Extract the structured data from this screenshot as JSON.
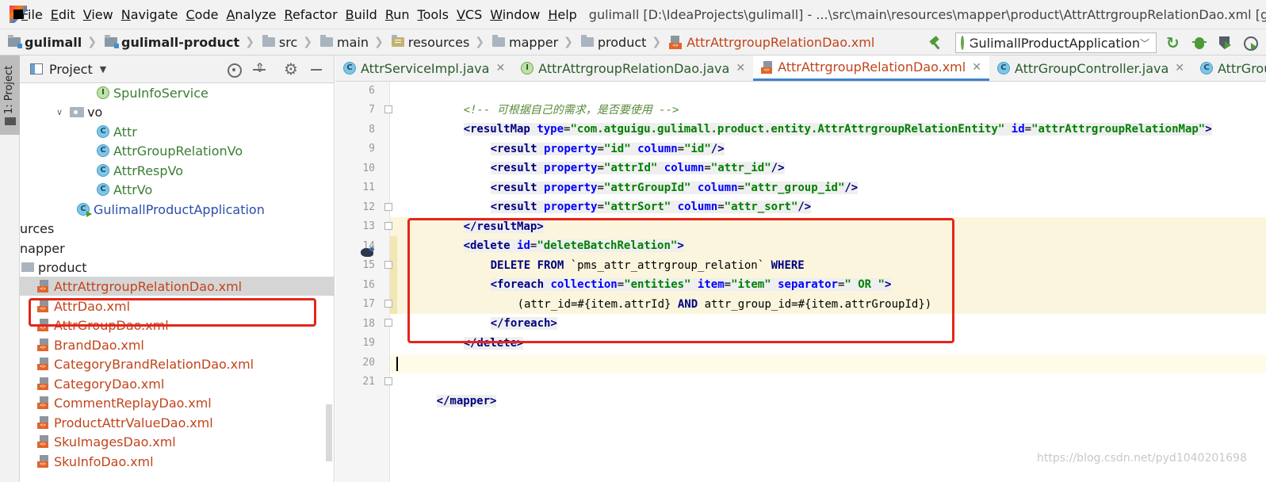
{
  "menubar": {
    "items": [
      "File",
      "Edit",
      "View",
      "Navigate",
      "Code",
      "Analyze",
      "Refactor",
      "Build",
      "Run",
      "Tools",
      "VCS",
      "Window",
      "Help"
    ],
    "window_title": "gulimall [D:\\IdeaProjects\\gulimall] - ...\\src\\main\\resources\\mapper\\product\\AttrAttrgroupRelationDao.xml [guli"
  },
  "breadcrumbs": [
    "gulimall",
    "gulimall-product",
    "src",
    "main",
    "resources",
    "mapper",
    "product",
    "AttrAttrgroupRelationDao.xml"
  ],
  "run_config": "GulimallProductApplication",
  "project_panel": {
    "title": "Project",
    "stripe_label": "1: Project",
    "tree": [
      {
        "label": "SpuInfoService",
        "icon": "interface-icon",
        "color": "#3b7e33"
      },
      {
        "label": "vo",
        "icon": "package-icon",
        "color": "#222222"
      },
      {
        "label": "Attr",
        "icon": "class-icon",
        "color": "#3b7e33"
      },
      {
        "label": "AttrGroupRelationVo",
        "icon": "class-icon",
        "color": "#3b7e33"
      },
      {
        "label": "AttrRespVo",
        "icon": "class-icon",
        "color": "#3b7e33"
      },
      {
        "label": "AttrVo",
        "icon": "class-icon",
        "color": "#3b7e33"
      },
      {
        "label": "GulimallProductApplication",
        "icon": "spring-app-icon",
        "color": "#2a4fa8"
      },
      {
        "label": "urces",
        "icon": "none",
        "color": "#222222"
      },
      {
        "label": "napper",
        "icon": "none",
        "color": "#222222"
      },
      {
        "label": "product",
        "icon": "folder-icon",
        "color": "#222222"
      },
      {
        "label": "AttrAttrgroupRelationDao.xml",
        "icon": "xml-file-icon",
        "color": "#c1441c"
      },
      {
        "label": "AttrDao.xml",
        "icon": "xml-file-icon",
        "color": "#c1441c"
      },
      {
        "label": "AttrGroupDao.xml",
        "icon": "xml-file-icon",
        "color": "#c1441c"
      },
      {
        "label": "BrandDao.xml",
        "icon": "xml-file-icon",
        "color": "#c1441c"
      },
      {
        "label": "CategoryBrandRelationDao.xml",
        "icon": "xml-file-icon",
        "color": "#c1441c"
      },
      {
        "label": "CategoryDao.xml",
        "icon": "xml-file-icon",
        "color": "#c1441c"
      },
      {
        "label": "CommentReplayDao.xml",
        "icon": "xml-file-icon",
        "color": "#c1441c"
      },
      {
        "label": "ProductAttrValueDao.xml",
        "icon": "xml-file-icon",
        "color": "#c1441c"
      },
      {
        "label": "SkuImagesDao.xml",
        "icon": "xml-file-icon",
        "color": "#c1441c"
      },
      {
        "label": "SkuInfoDao.xml",
        "icon": "xml-file-icon",
        "color": "#c1441c"
      }
    ],
    "selected_item": "AttrAttrgroupRelationDao.xml"
  },
  "editor": {
    "tabs": [
      {
        "label": "AttrServiceImpl.java",
        "icon": "class-icon",
        "active": false
      },
      {
        "label": "AttrAttrgroupRelationDao.java",
        "icon": "interface-icon",
        "active": false
      },
      {
        "label": "AttrAttrgroupRelationDao.xml",
        "icon": "xml-file-icon",
        "active": true
      },
      {
        "label": "AttrGroupController.java",
        "icon": "class-icon",
        "active": false
      },
      {
        "label": "AttrGroupRelatio",
        "icon": "class-icon",
        "active": false
      }
    ],
    "line_numbers": [
      "6",
      "7",
      "8",
      "9",
      "10",
      "11",
      "12",
      "13",
      "14",
      "15",
      "16",
      "17",
      "18",
      "19",
      "20",
      "21"
    ],
    "code": {
      "l6": "<!-- 可根据自己的需求，是否要使用 -->",
      "l7_tag": "<resultMap",
      "l7_a1": "type",
      "l7_v1": "\"com.atguigu.gulimall.product.entity.AttrAttrgroupRelationEntity\"",
      "l7_a2": "id",
      "l7_v2": "\"attrAttrgroupRelationMap\"",
      "l8_prop": "\"id\"",
      "l8_col": "\"id\"",
      "l9_prop": "\"attrId\"",
      "l9_col": "\"attr_id\"",
      "l10_prop": "\"attrGroupId\"",
      "l10_col": "\"attr_group_id\"",
      "l11_prop": "\"attrSort\"",
      "l11_col": "\"attr_sort\"",
      "l12": "</resultMap>",
      "l13_tag": "<delete",
      "l13_attr": "id",
      "l13_val": "\"deleteBatchRelation\"",
      "l14_kw1": "DELETE FROM",
      "l14_tbl": " `pms_attr_attrgroup_relation` ",
      "l14_kw2": "WHERE",
      "l15_tag": "<foreach",
      "l15_a1": "collection",
      "l15_v1": "\"entities\"",
      "l15_a2": "item",
      "l15_v2": "\"item\"",
      "l15_a3": "separator",
      "l15_v3": "\" OR \"",
      "l16_a": "(attr_id=#{item.attrId} ",
      "l16_kw": "AND",
      "l16_b": " attr_group_id=#{item.attrGroupId})",
      "l17": "</foreach>",
      "l18": "</delete>",
      "l21": "</mapper>",
      "result_tag": "<result",
      "property_attr": "property",
      "column_attr": "column",
      "self_close": "/>",
      "gt": ">",
      "eq": "="
    }
  },
  "watermark": "https://blog.csdn.net/pyd1040201698",
  "colors": {
    "highlight_box": "#e3261c",
    "xml_tag": "#000080",
    "xml_attr": "#0000ff",
    "xml_value": "#008000",
    "comment": "#5a8a3a",
    "selection_bg": "#d5d5d5",
    "active_tab_underline": "#4083c9"
  }
}
